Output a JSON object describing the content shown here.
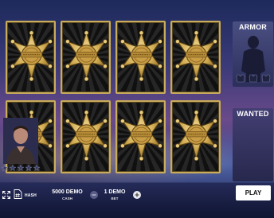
{
  "game": {
    "cards": [
      {
        "icon": "sheriff-badge-icon",
        "state": "covered"
      },
      {
        "icon": "sheriff-badge-icon",
        "state": "covered"
      },
      {
        "icon": "sheriff-badge-icon",
        "state": "covered"
      },
      {
        "icon": "sheriff-badge-icon",
        "state": "covered"
      },
      {
        "icon": "sheriff-badge-icon",
        "state": "covered"
      },
      {
        "icon": "sheriff-badge-icon",
        "state": "covered"
      },
      {
        "icon": "sheriff-badge-icon",
        "state": "covered"
      },
      {
        "icon": "sheriff-badge-icon",
        "state": "covered"
      }
    ],
    "armor_panel": {
      "title": "ARMOR",
      "pieces_icons": [
        "armor-vest-icon",
        "armor-vest-icon",
        "armor-vest-icon"
      ]
    },
    "wanted_panel": {
      "title": "WANTED",
      "stars_total": 5,
      "stars_filled": 0
    }
  },
  "controls": {
    "fullscreen_icon": "fullscreen-icon",
    "hash_icon": "document-hash-icon",
    "hash_label": "HASH",
    "cash_value": "5000 DEMO",
    "cash_label": "CASH",
    "bet_value": "1 DEMO",
    "bet_label": "BET",
    "play_label": "PLAY"
  },
  "colors": {
    "card_border": "#c9ab5c",
    "badge_gold": "#d9b85a",
    "play_button_bg": "#ffffff",
    "play_button_text": "#111111"
  }
}
